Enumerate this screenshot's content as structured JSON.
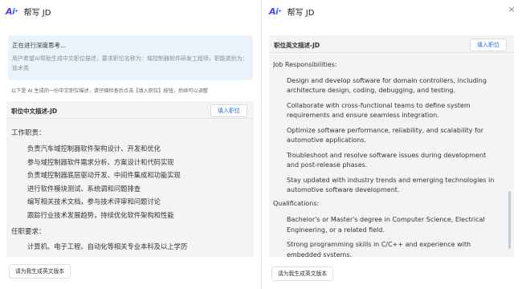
{
  "left": {
    "logo": "Ai",
    "title": "帮写 JD",
    "thinking_title": "正在进行深度思考...",
    "thinking_text": "用户希望AI帮助生成中文职位描述，要求职位名称为：域控制器软件研发工程师，职能类别为：技术类",
    "hint": "以下是 AI 生成的一份中文职位描述，请仔细检查后点击【填入职位】按钮，后续可以调整",
    "card_title": "职位中文描述-JD",
    "fill_btn": "填入职位",
    "sec1": "工作职责：",
    "items1": [
      "负责汽车域控制器软件架构设计、开发和优化",
      "参与域控制器软件需求分析、方案设计和代码实现",
      "负责域控制器底层驱动开发、中间件集成和功能实现",
      "进行软件模块测试、系统调和问题排查",
      "编写相关技术文档，参与技术评审和问题讨论",
      "跟踪行业技术发展趋势，持续优化软件架构和性能"
    ],
    "sec2": "任职要求：",
    "items2": [
      "计算机、电子工程、自动化等相关专业本科及以上学历"
    ],
    "gen_btn": "请为我生成英文版本"
  },
  "right": {
    "logo": "Ai",
    "title": "帮写 JD",
    "close": "×",
    "card_title": "职位英文描述-JD",
    "fill_btn": "填入职位",
    "sec1": "Job Responsibilities:",
    "items1": [
      "Design and develop software for domain controllers, including architecture design, coding, debugging, and testing.",
      "Collaborate with cross-functional teams to define system requirements and ensure seamless integration.",
      "Optimize software performance, reliability, and scalability for automotive applications.",
      "Troubleshoot and resolve software issues during development and post-release phases.",
      "Stay updated with industry trends and emerging technologies in automotive software development."
    ],
    "sec2": "Qualifications:",
    "items2": [
      "Bachelor's or Master's degree in Computer Science, Electrical Engineering, or a related field.",
      "Strong programming skills in C/C++ and experience with embedded systems."
    ],
    "gen_btn": "请为我生成英文版本"
  }
}
